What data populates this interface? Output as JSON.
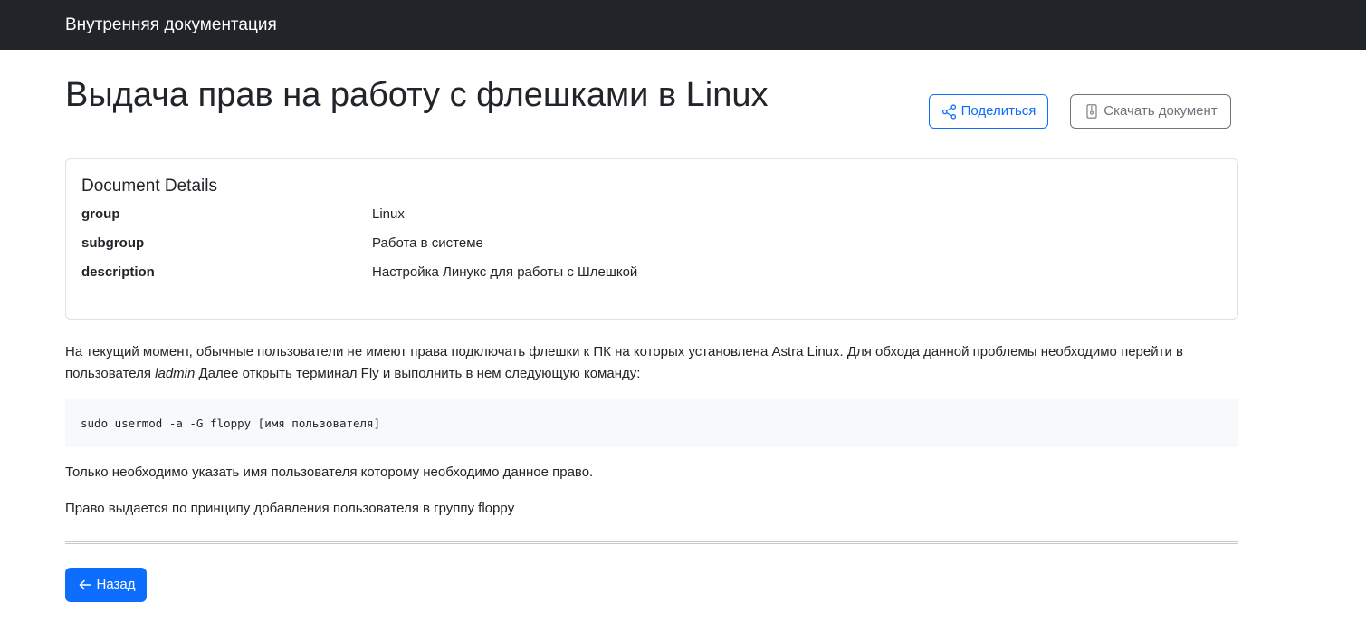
{
  "navbar": {
    "brand": "Внутренняя документация"
  },
  "page": {
    "title": "Выдача прав на работу с флешками в Linux"
  },
  "actions": {
    "share_label": "Поделиться",
    "share_icon": "share-icon",
    "download_label": "Скачать документ",
    "download_icon": "file-zip-icon"
  },
  "details": {
    "title": "Document Details",
    "rows": [
      {
        "key": "group",
        "value": "Linux"
      },
      {
        "key": "subgroup",
        "value": "Работа в системе"
      },
      {
        "key": "description",
        "value": "Настройка Линукс для работы с Шлешкой"
      }
    ]
  },
  "content": {
    "para1_part1": "На текущий момент, обычные пользователи не имеют права подключать флешки к ПК на которых установлена Astra Linux. Для обхода данной проблемы необходимо перейти в пользователя ",
    "para1_italic": "ladmin",
    "para1_part2": " Далее открыть терминал Fly и выполнить в нем следующую команду:",
    "code": "sudo usermod -a -G floppy [имя пользователя]",
    "para2": "Только необходимо указать имя пользователя которому необходимо данное право.",
    "para3": "Право выдается по принципу добавления пользователя в группу floppy"
  },
  "footer": {
    "back_label": "Назад",
    "back_icon": "arrow-left-icon"
  },
  "colors": {
    "navbar_bg": "#212529",
    "primary": "#0d6efd",
    "secondary": "#6c757d",
    "code_bg": "#f8f9fa"
  }
}
